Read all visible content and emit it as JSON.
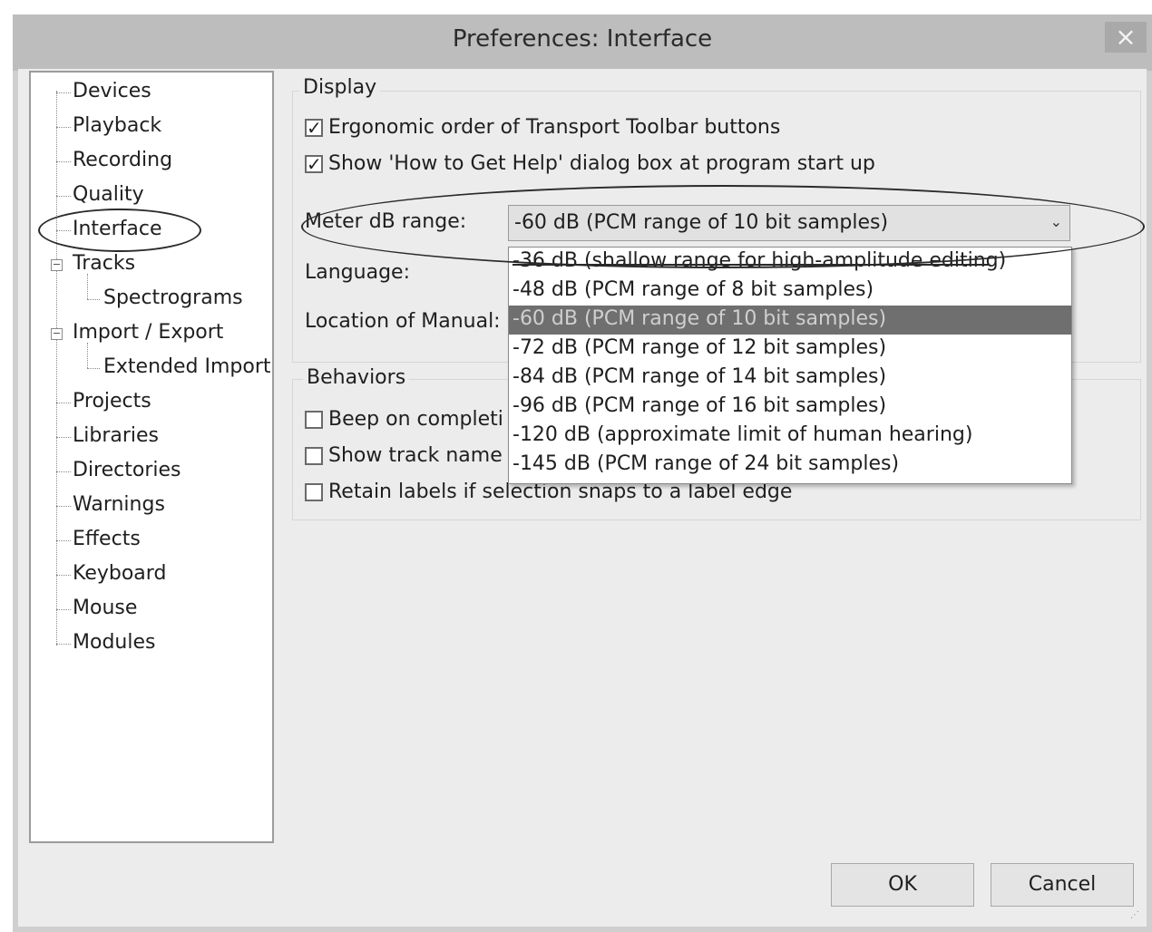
{
  "window": {
    "title": "Preferences: Interface",
    "close_label": "×"
  },
  "tree": {
    "items": [
      {
        "label": "Devices"
      },
      {
        "label": "Playback"
      },
      {
        "label": "Recording"
      },
      {
        "label": "Quality"
      },
      {
        "label": "Interface"
      },
      {
        "label": "Tracks"
      },
      {
        "label": "Spectrograms"
      },
      {
        "label": "Import / Export"
      },
      {
        "label": "Extended Import"
      },
      {
        "label": "Projects"
      },
      {
        "label": "Libraries"
      },
      {
        "label": "Directories"
      },
      {
        "label": "Warnings"
      },
      {
        "label": "Effects"
      },
      {
        "label": "Keyboard"
      },
      {
        "label": "Mouse"
      },
      {
        "label": "Modules"
      }
    ],
    "selected": "Interface"
  },
  "display": {
    "group_title": "Display",
    "ergonomic_label": "Ergonomic order of Transport Toolbar buttons",
    "ergonomic_checked": true,
    "help_label": "Show 'How to Get Help' dialog box at program start up",
    "help_checked": true,
    "meter_label": "Meter dB range:",
    "meter_value": "-60 dB (PCM range of 10 bit samples)",
    "language_label": "Language:",
    "manual_label": "Location of Manual:"
  },
  "dropdown": {
    "options": [
      "-36 dB (shallow range for high-amplitude editing)",
      "-48 dB (PCM range of 8 bit samples)",
      "-60 dB (PCM range of 10 bit samples)",
      "-72 dB (PCM range of 12 bit samples)",
      "-84 dB (PCM range of 14 bit samples)",
      "-96 dB (PCM range of 16 bit samples)",
      "-120 dB (approximate limit of human hearing)",
      "-145 dB (PCM range of 24 bit samples)"
    ],
    "selected": "-60 dB (PCM range of 10 bit samples)"
  },
  "behaviors": {
    "group_title": "Behaviors",
    "beep_label": "Beep on completi",
    "beep_checked": false,
    "track_name_label": "Show track name",
    "track_name_checked": false,
    "retain_label": "Retain labels if selection snaps to a label edge",
    "retain_checked": false
  },
  "buttons": {
    "ok_label": "OK",
    "cancel_label": "Cancel"
  },
  "colors": {
    "selected_item_bg": "#6f6f6f",
    "titlebar_bg": "#bdbdbd",
    "client_bg": "#ececec"
  }
}
